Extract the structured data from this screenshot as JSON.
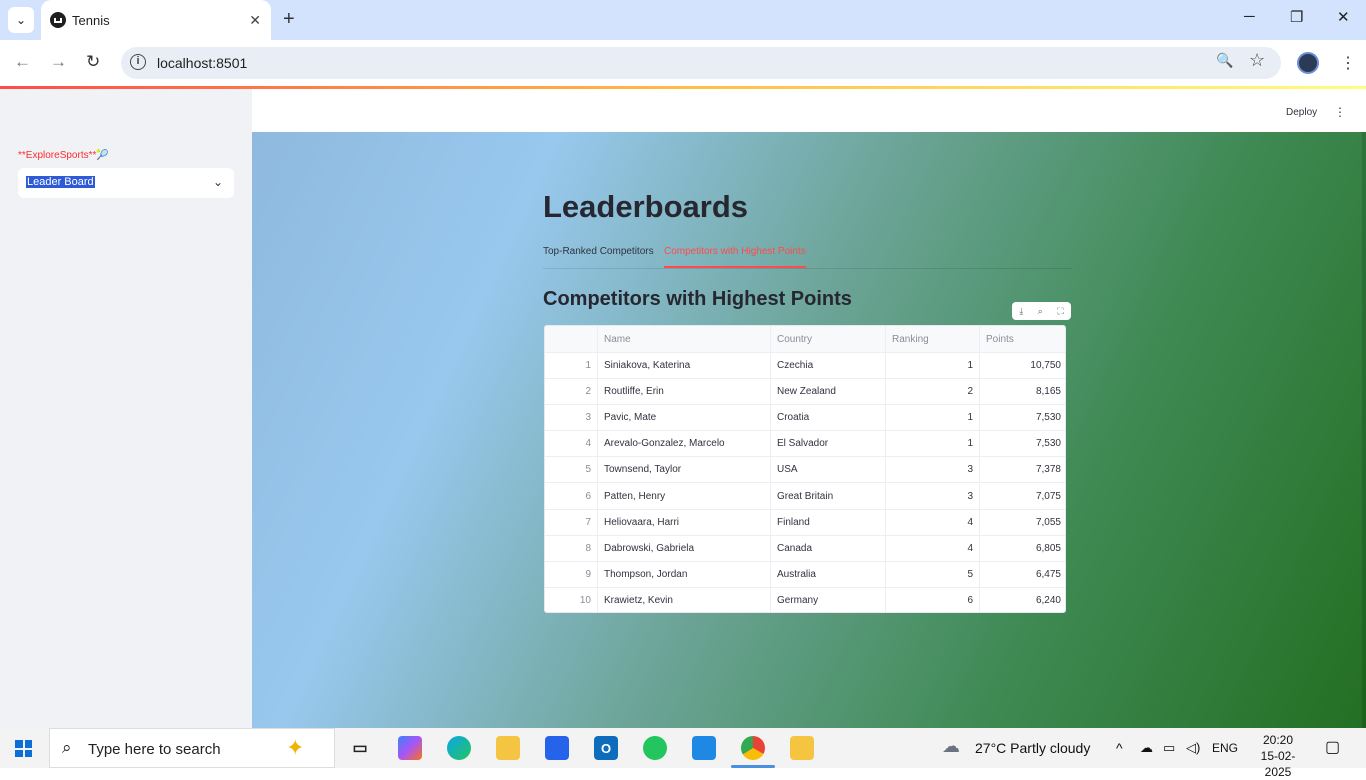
{
  "browser": {
    "tab_title": "Tennis",
    "url": "localhost:8501",
    "newtab_symbol": "+",
    "tab_close_symbol": "✕",
    "tab_menu_symbol": "⌄",
    "back_symbol": "←",
    "forward_symbol": "→",
    "reload_symbol": "↻",
    "info_symbol": "i",
    "zoom_symbol": "🔍",
    "star_symbol": "☆",
    "menu_symbol": "⋮",
    "minimize_symbol": "─",
    "restore_symbol": "❐",
    "close_symbol": "✕"
  },
  "app": {
    "deploy_label": "Deploy",
    "header_menu_symbol": "⋮",
    "sidebar": {
      "label": "**ExploreSports**🎾",
      "select_value": "Leader Board",
      "chevron": "⌄"
    },
    "page_title": "Leaderboards",
    "tabs": [
      {
        "label": "Top-Ranked Competitors",
        "active": false
      },
      {
        "label": "Competitors with Highest Points",
        "active": true
      }
    ],
    "subtitle": "Competitors with Highest Points",
    "table_toolbar": {
      "download": "⤓",
      "search": "⌕",
      "fullscreen": "⛶"
    },
    "table": {
      "columns": [
        "",
        "Name",
        "Country",
        "Ranking",
        "Points"
      ],
      "rows": [
        {
          "idx": "1",
          "name": "Siniakova, Katerina",
          "country": "Czechia",
          "ranking": "1",
          "points": "10,750"
        },
        {
          "idx": "2",
          "name": "Routliffe, Erin",
          "country": "New Zealand",
          "ranking": "2",
          "points": "8,165"
        },
        {
          "idx": "3",
          "name": "Pavic, Mate",
          "country": "Croatia",
          "ranking": "1",
          "points": "7,530"
        },
        {
          "idx": "4",
          "name": "Arevalo-Gonzalez, Marcelo",
          "country": "El Salvador",
          "ranking": "1",
          "points": "7,530"
        },
        {
          "idx": "5",
          "name": "Townsend, Taylor",
          "country": "USA",
          "ranking": "3",
          "points": "7,378"
        },
        {
          "idx": "6",
          "name": "Patten, Henry",
          "country": "Great Britain",
          "ranking": "3",
          "points": "7,075"
        },
        {
          "idx": "7",
          "name": "Heliovaara, Harri",
          "country": "Finland",
          "ranking": "4",
          "points": "7,055"
        },
        {
          "idx": "8",
          "name": "Dabrowski, Gabriela",
          "country": "Canada",
          "ranking": "4",
          "points": "6,805"
        },
        {
          "idx": "9",
          "name": "Thompson, Jordan",
          "country": "Australia",
          "ranking": "5",
          "points": "6,475"
        },
        {
          "idx": "10",
          "name": "Krawietz, Kevin",
          "country": "Germany",
          "ranking": "6",
          "points": "6,240"
        }
      ]
    }
  },
  "taskbar": {
    "search_placeholder": "Type here to search",
    "search_icon": "⌕",
    "copilot_star": "✦",
    "weather": "27°C  Partly cloudy",
    "weather_icon": "☁",
    "lang": "ENG",
    "time": "20:20",
    "date": "15-02-2025",
    "chevron": "^",
    "notification_icon": "▢"
  },
  "colors": {
    "accent": "#ff4b4b",
    "chrome_top": "#d3e3fd",
    "sidebar_bg": "#f0f2f6"
  }
}
